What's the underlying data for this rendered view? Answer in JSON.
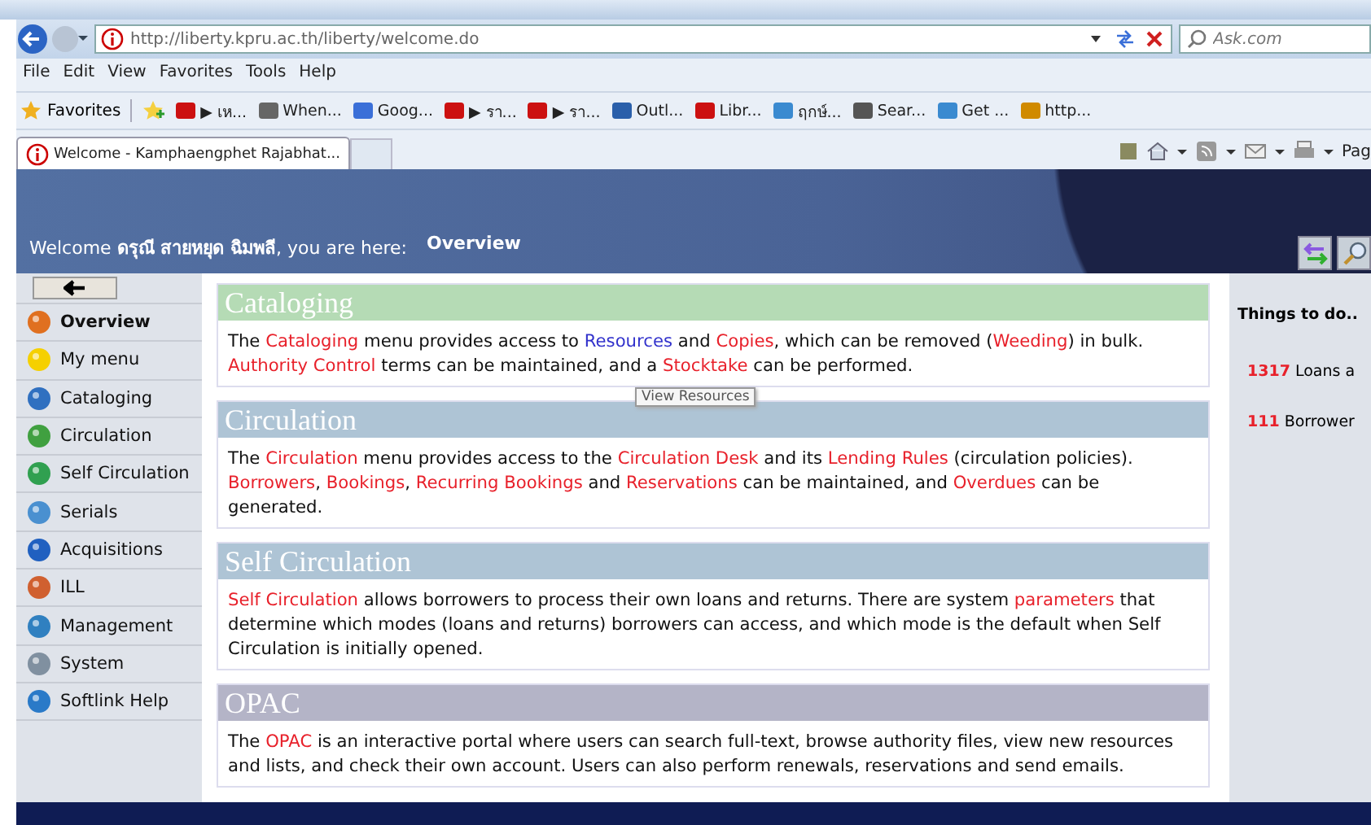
{
  "browser": {
    "address": "http://liberty.kpru.ac.th/liberty/welcome.do",
    "search": {
      "placeholder": "Ask.com"
    },
    "menu": [
      "File",
      "Edit",
      "View",
      "Favorites",
      "Tools",
      "Help"
    ],
    "favorites_label": "Favorites",
    "favorites": [
      "▶ เห...",
      "When...",
      "Goog...",
      "▶ รา...",
      "▶ รา...",
      "Outl...",
      "Libr...",
      "ฤกษ์...",
      "Sear...",
      "Get ...",
      "http..."
    ],
    "tab": "Welcome - Kamphaengphet Rajabhat...",
    "page_menu": "Pag"
  },
  "header": {
    "welcome": "Welcome **ดรุณี สายหยุด ฉิมพลี**, you are here:",
    "location": "Overview"
  },
  "sidebar": {
    "items": [
      {
        "label": "Overview",
        "selected": true
      },
      {
        "label": "My menu",
        "selected": false
      },
      {
        "label": "Cataloging",
        "selected": false
      },
      {
        "label": "Circulation",
        "selected": false
      },
      {
        "label": "Self Circulation",
        "selected": false
      },
      {
        "label": "Serials",
        "selected": false
      },
      {
        "label": "Acquisitions",
        "selected": false
      },
      {
        "label": "ILL",
        "selected": false
      },
      {
        "label": "Management",
        "selected": false
      },
      {
        "label": "System",
        "selected": false
      },
      {
        "label": "Softlink Help",
        "selected": false
      }
    ]
  },
  "sections": [
    {
      "title": "Cataloging",
      "color": "#b5dbb5",
      "text": [
        {
          "kind": "plain",
          "text": "The "
        },
        {
          "kind": "link",
          "text": "Cataloging"
        },
        {
          "kind": "plain",
          "text": " menu provides access to "
        },
        {
          "kind": "hover",
          "text": "Resources"
        },
        {
          "kind": "plain",
          "text": " and "
        },
        {
          "kind": "link",
          "text": "Copies"
        },
        {
          "kind": "plain",
          "text": ", which can be removed ("
        },
        {
          "kind": "link",
          "text": "Weeding"
        },
        {
          "kind": "plain",
          "text": ") in bulk. "
        },
        {
          "kind": "link",
          "text": "Authority Control"
        },
        {
          "kind": "plain",
          "text": " terms can be maintained, and a "
        },
        {
          "kind": "link",
          "text": "Stocktake"
        },
        {
          "kind": "plain",
          "text": " can be performed."
        }
      ],
      "tooltip": "View Resources"
    },
    {
      "title": "Circulation",
      "color": "#aec4d5",
      "text": [
        {
          "kind": "plain",
          "text": "The "
        },
        {
          "kind": "link",
          "text": "Circulation"
        },
        {
          "kind": "plain",
          "text": " menu provides access to the "
        },
        {
          "kind": "link",
          "text": "Circulation Desk"
        },
        {
          "kind": "plain",
          "text": " and its "
        },
        {
          "kind": "link",
          "text": "Lending Rules"
        },
        {
          "kind": "plain",
          "text": " (circulation policies). "
        },
        {
          "kind": "link",
          "text": "Borrowers"
        },
        {
          "kind": "plain",
          "text": ", "
        },
        {
          "kind": "link",
          "text": "Bookings"
        },
        {
          "kind": "plain",
          "text": ", "
        },
        {
          "kind": "link",
          "text": "Recurring Bookings"
        },
        {
          "kind": "plain",
          "text": " and "
        },
        {
          "kind": "link",
          "text": "Reservations"
        },
        {
          "kind": "plain",
          "text": " can be maintained, and "
        },
        {
          "kind": "link",
          "text": "Overdues"
        },
        {
          "kind": "plain",
          "text": " can be generated."
        }
      ]
    },
    {
      "title": "Self Circulation",
      "color": "#aec4d5",
      "text": [
        {
          "kind": "link",
          "text": "Self Circulation"
        },
        {
          "kind": "plain",
          "text": " allows borrowers to process their own loans and returns. There are system "
        },
        {
          "kind": "link",
          "text": "parameters"
        },
        {
          "kind": "plain",
          "text": " that determine which modes (loans and returns) borrowers can access, and which mode is the default when Self Circulation is initially opened."
        }
      ]
    },
    {
      "title": "OPAC",
      "color": "#b4b4c7",
      "text": [
        {
          "kind": "plain",
          "text": "The "
        },
        {
          "kind": "link",
          "text": "OPAC"
        },
        {
          "kind": "plain",
          "text": " is an interactive portal where users can search full-text, browse authority files, view new resources and lists, and check their own account. Users can also perform renewals, reservations and send emails."
        }
      ]
    }
  ],
  "todo": {
    "title": "Things to do..",
    "items": [
      {
        "count": "1317",
        "text": "Loans a"
      },
      {
        "count": "111",
        "text": "Borrower"
      }
    ]
  }
}
